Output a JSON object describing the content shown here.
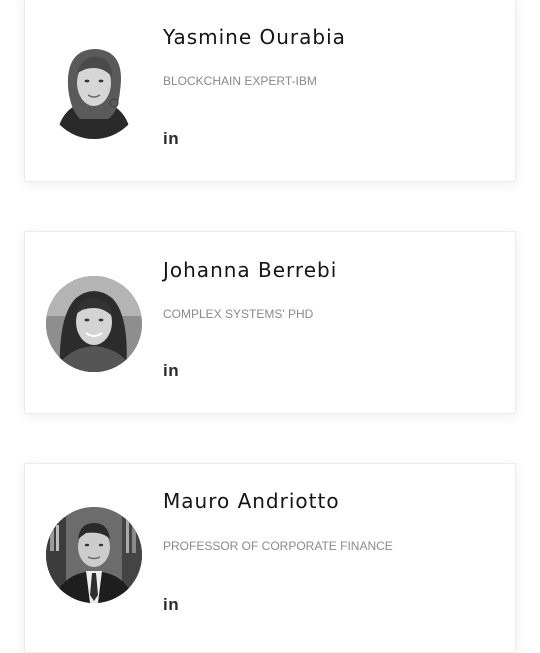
{
  "team": {
    "members": [
      {
        "name": "Yasmine Ourabia",
        "role": "BLOCKCHAIN EXPERT-IBM",
        "social": {
          "icon": "linkedin-icon",
          "label": "in"
        }
      },
      {
        "name": "Johanna Berrebi",
        "role": "COMPLEX SYSTEMS' PHD",
        "social": {
          "icon": "linkedin-icon",
          "label": "in"
        }
      },
      {
        "name": "Mauro Andriotto",
        "role": "PROFESSOR OF CORPORATE FINANCE",
        "social": {
          "icon": "linkedin-icon",
          "label": "in"
        }
      }
    ]
  },
  "colors": {
    "name_text": "#141414",
    "role_text": "#8a8a8a",
    "icon": "#2b2b2b",
    "card_border": "#ececec"
  }
}
